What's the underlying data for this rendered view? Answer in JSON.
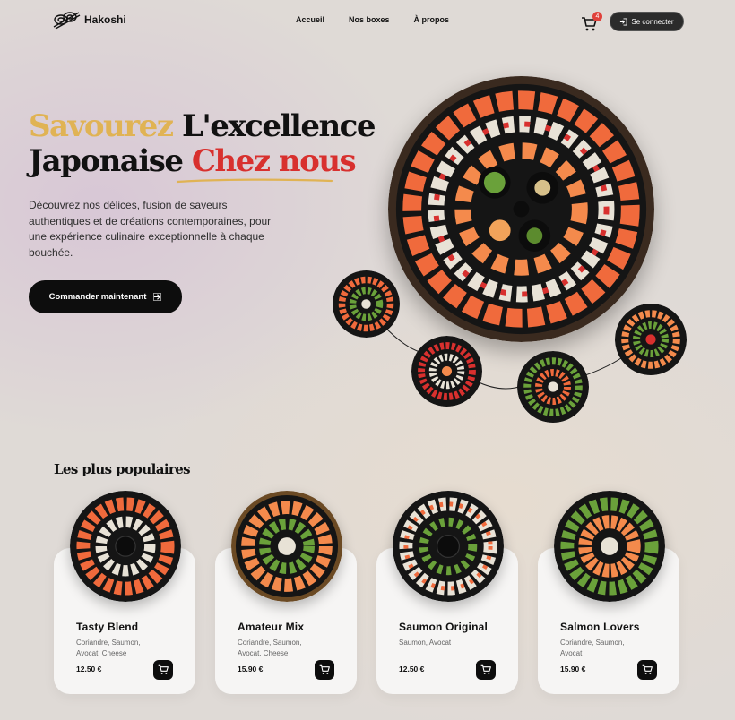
{
  "brand": {
    "name": "Hakoshi"
  },
  "nav": {
    "items": [
      "Accueil",
      "Nos boxes",
      "À propos"
    ]
  },
  "cart": {
    "count": "4"
  },
  "auth": {
    "login_label": "Se connecter"
  },
  "hero": {
    "title_word1": "Savourez",
    "title_word2": "L'excellence",
    "title_word3": "Japonaise",
    "title_word4": "Chez nous",
    "description": "Découvrez nos délices, fusion de saveurs authentiques et de créations contemporaines, pour une expérience culinaire exceptionnelle à chaque bouchée.",
    "cta_label": "Commander maintenant"
  },
  "colors": {
    "gold": "#e0b354",
    "red": "#d8302e",
    "dark": "#0d0d0d"
  },
  "popular": {
    "title": "Les plus populaires",
    "items": [
      {
        "name": "Tasty Blend",
        "ingredients": "Coriandre, Saumon, Avocat, Cheese",
        "price": "12.50 €"
      },
      {
        "name": "Amateur Mix",
        "ingredients": "Coriandre, Saumon, Avocat, Cheese",
        "price": "15.90 €"
      },
      {
        "name": "Saumon Original",
        "ingredients": "Saumon, Avocat",
        "price": "12.50 €"
      },
      {
        "name": "Salmon Lovers",
        "ingredients": "Coriandre, Saumon, Avocat",
        "price": "15.90 €"
      }
    ]
  },
  "icons": [
    "sushi-logo-icon",
    "cart-icon",
    "login-icon",
    "arrow-right-icon"
  ]
}
